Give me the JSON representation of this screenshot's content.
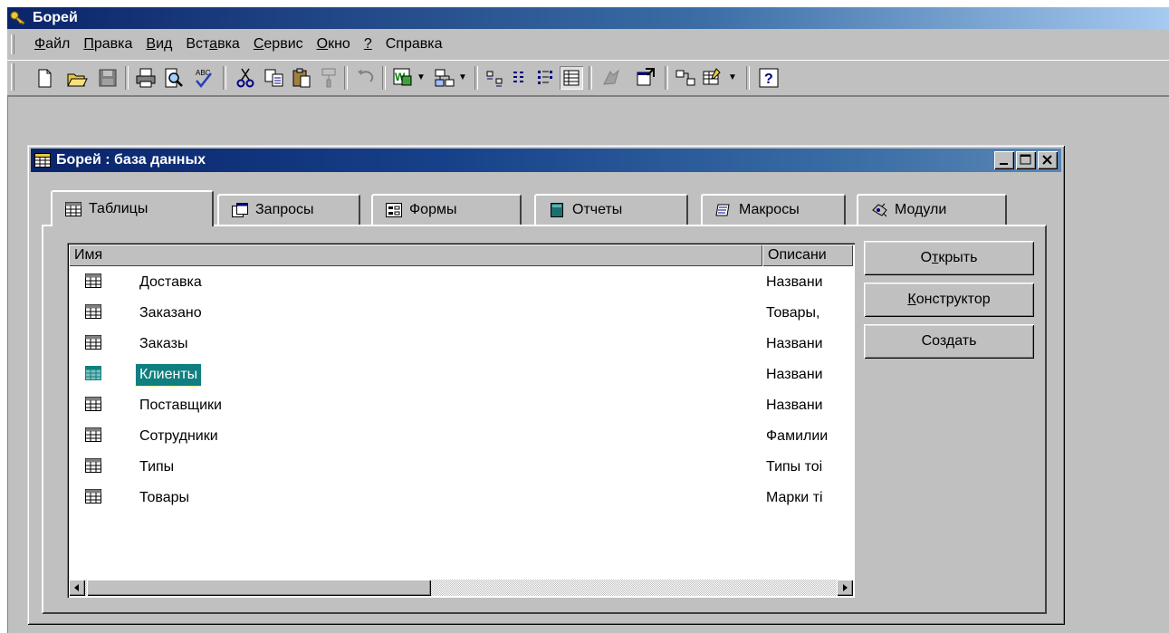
{
  "app": {
    "title": "Борей",
    "menu": [
      {
        "pre": "",
        "key": "Ф",
        "post": "айл"
      },
      {
        "pre": "",
        "key": "П",
        "post": "равка"
      },
      {
        "pre": "",
        "key": "В",
        "post": "ид"
      },
      {
        "pre": "Вст",
        "key": "а",
        "post": "вка"
      },
      {
        "pre": "",
        "key": "С",
        "post": "ервис"
      },
      {
        "pre": "",
        "key": "О",
        "post": "кно"
      },
      {
        "pre": "",
        "key": "?",
        "post": ""
      },
      {
        "pre": "Справка",
        "key": "",
        "post": ""
      }
    ]
  },
  "toolbar": {
    "icons": [
      "new-icon",
      "open-icon",
      "save-icon",
      "print-icon",
      "preview-icon",
      "spelling-icon",
      "cut-icon",
      "copy-icon",
      "paste-icon",
      "format-painter-icon",
      "undo-icon",
      "office-links-icon",
      "analyze-icon",
      "large-icons-icon",
      "small-icons-icon",
      "list-icon",
      "details-icon",
      "code-icon",
      "properties-icon",
      "relationships-icon",
      "new-object-icon",
      "help-icon"
    ]
  },
  "db_window": {
    "title": "Борей : база данных",
    "tabs": [
      {
        "label": "Таблицы",
        "icon": "table-icon",
        "active": true
      },
      {
        "label": "Запросы",
        "icon": "query-icon",
        "active": false
      },
      {
        "label": "Формы",
        "icon": "form-icon",
        "active": false
      },
      {
        "label": "Отчеты",
        "icon": "report-icon",
        "active": false
      },
      {
        "label": "Макросы",
        "icon": "macro-icon",
        "active": false
      },
      {
        "label": "Модули",
        "icon": "module-icon",
        "active": false
      }
    ],
    "columns": {
      "name": "Имя",
      "description": "Описани"
    },
    "rows": [
      {
        "name": "Доставка",
        "description": "Названи",
        "selected": false
      },
      {
        "name": "Заказано",
        "description": "Товары,",
        "selected": false
      },
      {
        "name": "Заказы",
        "description": "Названи",
        "selected": false
      },
      {
        "name": "Клиенты",
        "description": "Названи",
        "selected": true
      },
      {
        "name": "Поставщики",
        "description": "Названи",
        "selected": false
      },
      {
        "name": "Сотрудники",
        "description": "Фамилии",
        "selected": false
      },
      {
        "name": "Типы",
        "description": "Типы тоі",
        "selected": false
      },
      {
        "name": "Товары",
        "description": "Марки ті",
        "selected": false
      }
    ],
    "buttons": {
      "open": {
        "pre": "О",
        "key": "т",
        "post": "крыть"
      },
      "design": {
        "pre": "",
        "key": "К",
        "post": "онструктор"
      },
      "create": {
        "pre": "Соз",
        "key": "д",
        "post": "ать"
      }
    }
  },
  "colors": {
    "selection": "#0f7f7f",
    "titlebar": "#0a246a",
    "face": "#c0c0c0"
  }
}
